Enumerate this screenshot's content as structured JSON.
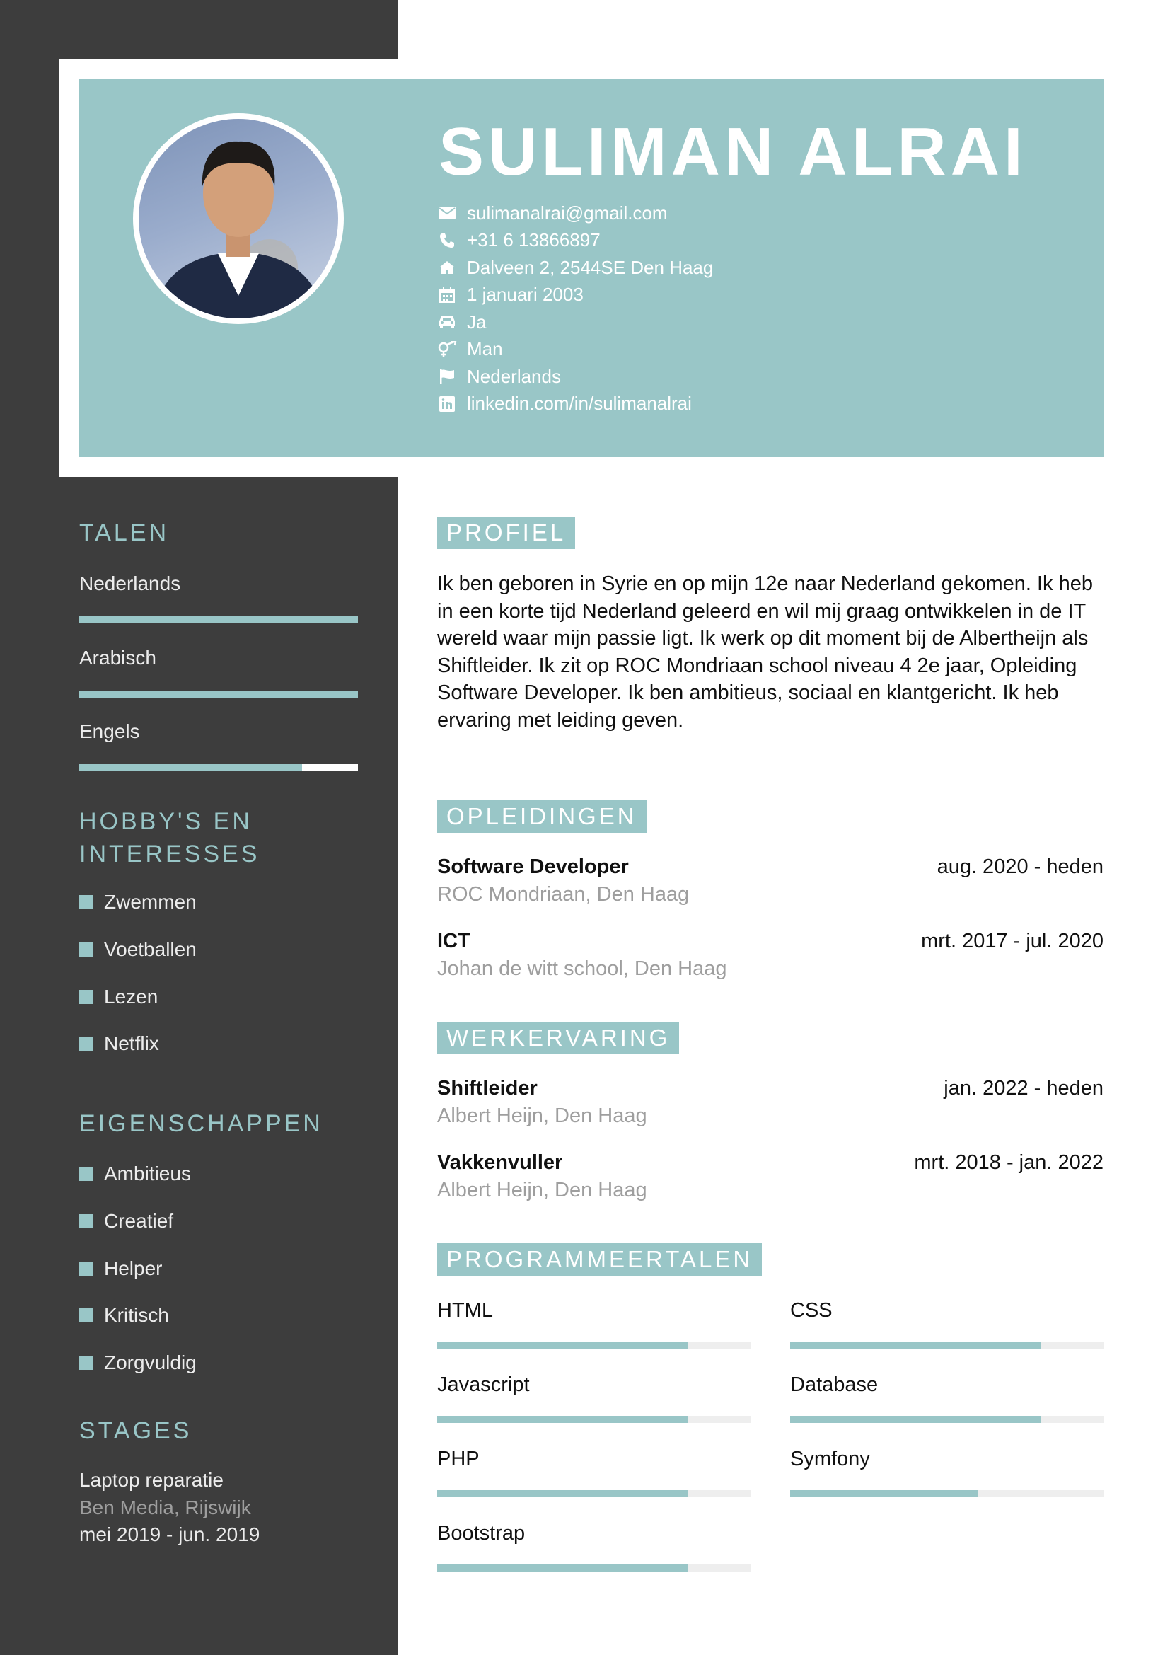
{
  "colors": {
    "accent": "#99c6c7",
    "sidebar": "#3d3d3d",
    "muted": "#9e9e9e"
  },
  "header": {
    "name": "SULIMAN ALRAI",
    "contacts": [
      {
        "icon": "envelope-icon",
        "text": "sulimanalrai@gmail.com"
      },
      {
        "icon": "phone-icon",
        "text": "+31 6 13866897"
      },
      {
        "icon": "home-icon",
        "text": "Dalveen 2, 2544SE Den Haag"
      },
      {
        "icon": "calendar-icon",
        "text": "1 januari 2003"
      },
      {
        "icon": "car-icon",
        "text": "Ja"
      },
      {
        "icon": "gender-icon",
        "text": "Man"
      },
      {
        "icon": "flag-icon",
        "text": "Nederlands"
      },
      {
        "icon": "linkedin-icon",
        "text": "linkedin.com/in/sulimanalrai"
      }
    ]
  },
  "sidebar": {
    "languages_title": "TALEN",
    "languages": [
      {
        "label": "Nederlands",
        "level": 1.0
      },
      {
        "label": "Arabisch",
        "level": 1.0
      },
      {
        "label": "Engels",
        "level": 0.8
      }
    ],
    "hobbies_title_line1": "HOBBY'S EN",
    "hobbies_title_line2": "INTERESSES",
    "hobbies": [
      "Zwemmen",
      "Voetballen",
      "Lezen",
      "Netflix"
    ],
    "traits_title": "EIGENSCHAPPEN",
    "traits": [
      "Ambitieus",
      "Creatief",
      "Helper",
      "Kritisch",
      "Zorgvuldig"
    ],
    "stages_title": "STAGES",
    "stage": {
      "title": "Laptop reparatie",
      "place": "Ben Media, Rijswijk",
      "period": "mei 2019 - jun. 2019"
    }
  },
  "main": {
    "profile_title": "PROFIEL",
    "profile_text": "Ik ben geboren in Syrie en op mijn 12e naar Nederland gekomen. Ik heb in een korte tijd Nederland geleerd en wil mij graag ontwikkelen in de IT wereld waar mijn passie ligt. Ik werk op dit moment bij de Albertheijn als Shiftleider. Ik zit op ROC Mondriaan school niveau 4 2e jaar, Opleiding Software Developer. Ik ben ambitieus, sociaal en klantgericht. Ik heb ervaring met leiding geven.",
    "education_title": "OPLEIDINGEN",
    "education": [
      {
        "title": "Software Developer",
        "period": "aug. 2020 - heden",
        "place": "ROC Mondriaan, Den Haag"
      },
      {
        "title": "ICT",
        "period": "mrt. 2017 - jul. 2020",
        "place": "Johan de witt school, Den Haag"
      }
    ],
    "work_title": "WERKERVARING",
    "work": [
      {
        "title": "Shiftleider",
        "period": "jan. 2022 - heden",
        "place": "Albert Heijn, Den Haag"
      },
      {
        "title": "Vakkenvuller",
        "period": "mrt. 2018 - jan. 2022",
        "place": "Albert Heijn, Den Haag"
      }
    ],
    "skills_title": "PROGRAMMEERTALEN",
    "skills": [
      {
        "label": "HTML",
        "level": 0.8
      },
      {
        "label": "CSS",
        "level": 0.8
      },
      {
        "label": "Javascript",
        "level": 0.8
      },
      {
        "label": "Database",
        "level": 0.8
      },
      {
        "label": "PHP",
        "level": 0.8
      },
      {
        "label": "Symfony",
        "level": 0.6
      },
      {
        "label": "Bootstrap",
        "level": 0.8
      }
    ]
  }
}
